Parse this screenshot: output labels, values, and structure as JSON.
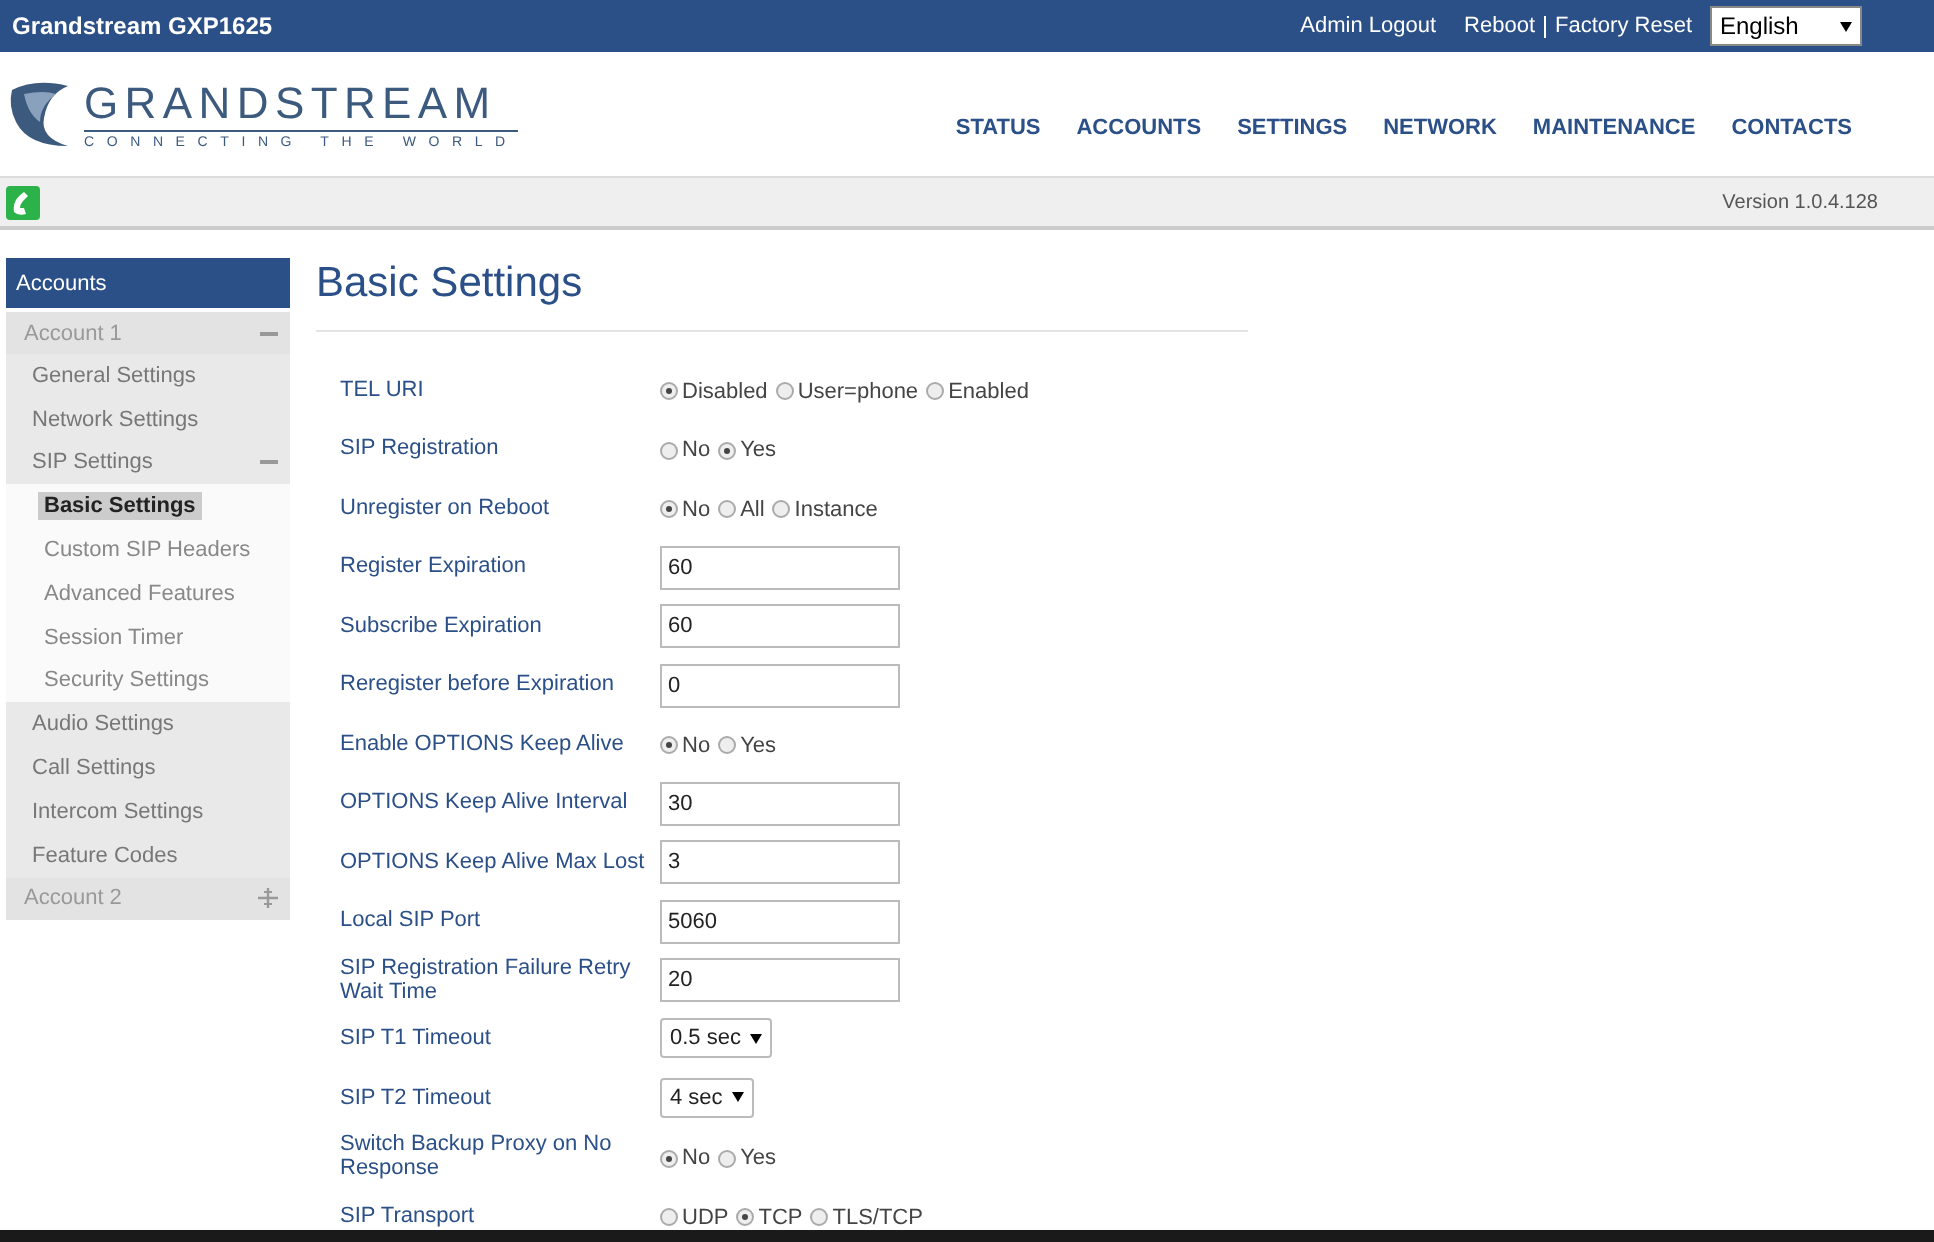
{
  "topbar": {
    "title": "Grandstream GXP1625",
    "links": [
      "Admin Logout",
      "Reboot",
      "Factory Reset"
    ],
    "language": "English"
  },
  "header": {
    "logo_name": "GRANDSTREAM",
    "logo_tagline": "CONNECTING THE WORLD",
    "nav": [
      "STATUS",
      "ACCOUNTS",
      "SETTINGS",
      "NETWORK",
      "MAINTENANCE",
      "CONTACTS"
    ]
  },
  "status_bar": {
    "version": "Version 1.0.4.128"
  },
  "sidebar": {
    "title": "Accounts",
    "accounts": [
      {
        "label": "Account 1",
        "expanded": true,
        "children": [
          {
            "label": "General Settings",
            "selected": false
          },
          {
            "label": "Network Settings",
            "selected": false
          },
          {
            "label": "SIP Settings",
            "selected": false,
            "expanded": true,
            "children": [
              {
                "label": "Basic Settings",
                "selected": true
              },
              {
                "label": "Custom SIP Headers",
                "selected": false
              },
              {
                "label": "Advanced Features",
                "selected": false
              },
              {
                "label": "Session Timer",
                "selected": false
              },
              {
                "label": "Security Settings",
                "selected": false
              }
            ]
          },
          {
            "label": "Audio Settings",
            "selected": false
          },
          {
            "label": "Call Settings",
            "selected": false
          },
          {
            "label": "Intercom Settings",
            "selected": false
          },
          {
            "label": "Feature Codes",
            "selected": false
          }
        ]
      },
      {
        "label": "Account 2",
        "expanded": false
      }
    ]
  },
  "page_title": "Basic Settings",
  "settings": [
    {
      "label": "TEL URI",
      "kind": "radio",
      "options": [
        {
          "label": "Disabled",
          "selected": true
        },
        {
          "label": "User=phone",
          "selected": false
        },
        {
          "label": "Enabled",
          "selected": false
        }
      ]
    },
    {
      "label": "SIP Registration",
      "kind": "radio",
      "options": [
        {
          "label": "No",
          "selected": false
        },
        {
          "label": "Yes",
          "selected": true
        }
      ]
    },
    {
      "label": "Unregister on Reboot",
      "kind": "radio",
      "options": [
        {
          "label": "No",
          "selected": true
        },
        {
          "label": "All",
          "selected": false
        },
        {
          "label": "Instance",
          "selected": false
        }
      ]
    },
    {
      "label": "Register Expiration",
      "kind": "text",
      "value": "60"
    },
    {
      "label": "Subscribe Expiration",
      "kind": "text",
      "value": "60"
    },
    {
      "label": "Reregister before Expiration",
      "kind": "text",
      "value": "0"
    },
    {
      "label": "Enable OPTIONS Keep Alive",
      "kind": "radio",
      "options": [
        {
          "label": "No",
          "selected": true
        },
        {
          "label": "Yes",
          "selected": false
        }
      ]
    },
    {
      "label": "OPTIONS Keep Alive Interval",
      "kind": "text",
      "value": "30"
    },
    {
      "label": "OPTIONS Keep Alive Max Lost",
      "kind": "text",
      "value": "3"
    },
    {
      "label": "Local SIP Port",
      "kind": "text",
      "value": "5060"
    },
    {
      "label": "SIP Registration Failure Retry Wait Time",
      "kind": "text",
      "value": "20"
    },
    {
      "label": "SIP T1 Timeout",
      "kind": "select",
      "value": "0.5 sec"
    },
    {
      "label": "SIP T2 Timeout",
      "kind": "select",
      "value": "4 sec"
    },
    {
      "label": "Switch Backup Proxy on No Response",
      "kind": "radio",
      "options": [
        {
          "label": "No",
          "selected": true
        },
        {
          "label": "Yes",
          "selected": false
        }
      ]
    },
    {
      "label": "SIP Transport",
      "kind": "radio",
      "options": [
        {
          "label": "UDP",
          "selected": false
        },
        {
          "label": "TCP",
          "selected": true
        },
        {
          "label": "TLS/TCP",
          "selected": false
        }
      ]
    }
  ]
}
